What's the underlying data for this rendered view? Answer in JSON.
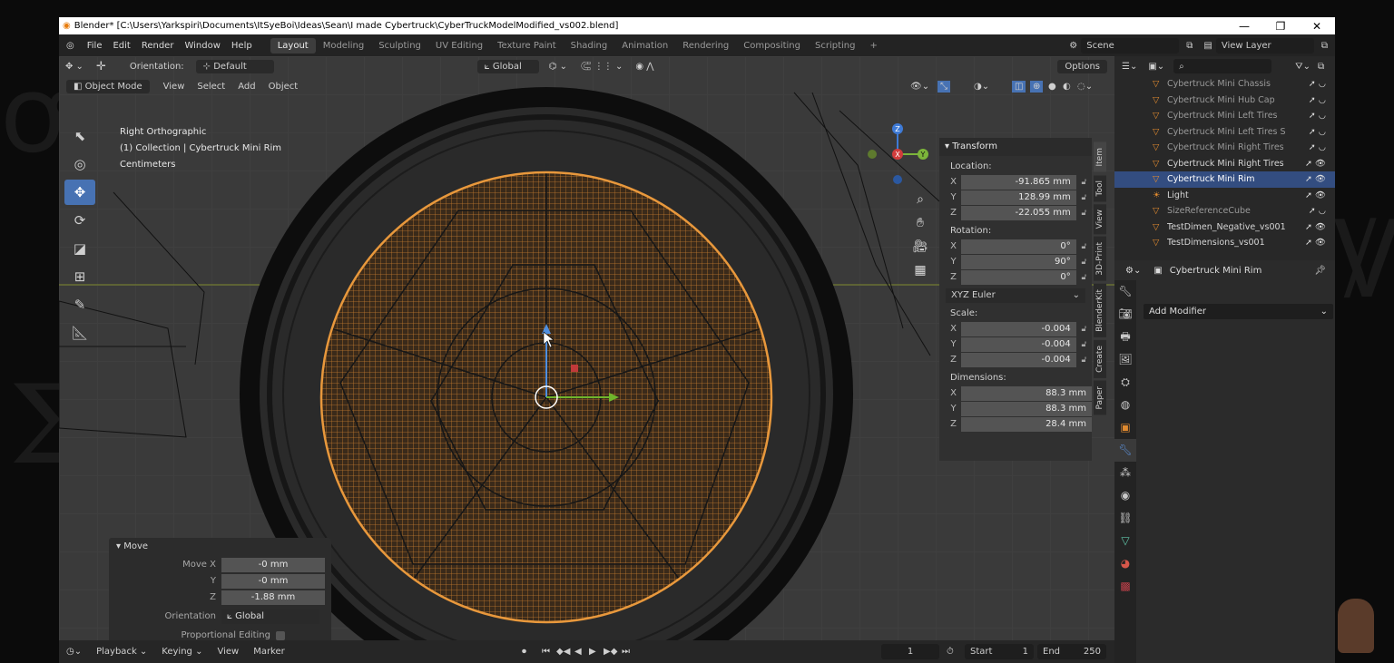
{
  "window": {
    "title": "Blender* [C:\\Users\\Yarkspiri\\Documents\\ItSyeBoi\\Ideas\\Sean\\I made  Cybertruck\\CyberTruckModelModified_vs002.blend]",
    "controls": [
      "—",
      "❐",
      "✕"
    ]
  },
  "menu": [
    "File",
    "Edit",
    "Render",
    "Window",
    "Help"
  ],
  "workspaces": [
    "Layout",
    "Modeling",
    "Sculpting",
    "UV Editing",
    "Texture Paint",
    "Shading",
    "Animation",
    "Rendering",
    "Compositing",
    "Scripting"
  ],
  "workspace_add": "+",
  "scene": {
    "label": "Scene",
    "view_layer": "View Layer"
  },
  "tool_header": {
    "orientation_label": "Orientation:",
    "orientation_value": "Default",
    "transform_space": "Global",
    "options": "Options"
  },
  "viewport_header": {
    "mode": "Object Mode",
    "menus": [
      "View",
      "Select",
      "Add",
      "Object"
    ]
  },
  "viewport_info": {
    "view": "Right Orthographic",
    "collection": "(1) Collection | Cybertruck Mini Rim",
    "units": "Centimeters"
  },
  "gizmo": {
    "x": "X",
    "y": "Y",
    "z": "Z"
  },
  "npanel": {
    "header": "Transform",
    "location_label": "Location:",
    "location": [
      {
        "axis": "X",
        "value": "-91.865 mm"
      },
      {
        "axis": "Y",
        "value": "128.99 mm"
      },
      {
        "axis": "Z",
        "value": "-22.055 mm"
      }
    ],
    "rotation_label": "Rotation:",
    "rotation": [
      {
        "axis": "X",
        "value": "0°"
      },
      {
        "axis": "Y",
        "value": "90°"
      },
      {
        "axis": "Z",
        "value": "0°"
      }
    ],
    "rotation_mode": "XYZ Euler",
    "scale_label": "Scale:",
    "scale": [
      {
        "axis": "X",
        "value": "-0.004"
      },
      {
        "axis": "Y",
        "value": "-0.004"
      },
      {
        "axis": "Z",
        "value": "-0.004"
      }
    ],
    "dimensions_label": "Dimensions:",
    "dimensions": [
      {
        "axis": "X",
        "value": "88.3 mm"
      },
      {
        "axis": "Y",
        "value": "88.3 mm"
      },
      {
        "axis": "Z",
        "value": "28.4 mm"
      }
    ],
    "tabs": [
      "Item",
      "Tool",
      "View",
      "3D-Print",
      "BlenderKit",
      "Create",
      "Paper"
    ]
  },
  "move_panel": {
    "title": "Move",
    "move_x_label": "Move X",
    "move_x": "-0 mm",
    "y_label": "Y",
    "y": "-0 mm",
    "z_label": "Z",
    "z": "-1.88 mm",
    "orientation_label": "Orientation",
    "orientation": "Global",
    "proportional": "Proportional Editing"
  },
  "timeline": {
    "menus": [
      "Playback",
      "Keying",
      "View",
      "Marker"
    ],
    "frame": "1",
    "start_label": "Start",
    "start": "1",
    "end_label": "End",
    "end": "250"
  },
  "outliner": {
    "items": [
      {
        "name": "Cybertruck Mini Chassis",
        "state": "dim"
      },
      {
        "name": "Cybertruck Mini Hub Cap",
        "state": "dim"
      },
      {
        "name": "Cybertruck Mini Left Tires",
        "state": "dim"
      },
      {
        "name": "Cybertruck Mini Left Tires Sir",
        "state": "dim"
      },
      {
        "name": "Cybertruck Mini Right Tires",
        "state": "dim"
      },
      {
        "name": "Cybertruck Mini Right Tires S",
        "state": "vis"
      },
      {
        "name": "Cybertruck Mini Rim",
        "state": "sel"
      },
      {
        "name": "Light",
        "state": "vis"
      },
      {
        "name": "SizeReferenceCube",
        "state": "dim"
      },
      {
        "name": "TestDimen_Negative_vs001",
        "state": "vis"
      },
      {
        "name": "TestDimensions_vs001",
        "state": "vis"
      }
    ]
  },
  "properties": {
    "object_name": "Cybertruck Mini Rim",
    "add_modifier": "Add Modifier"
  }
}
